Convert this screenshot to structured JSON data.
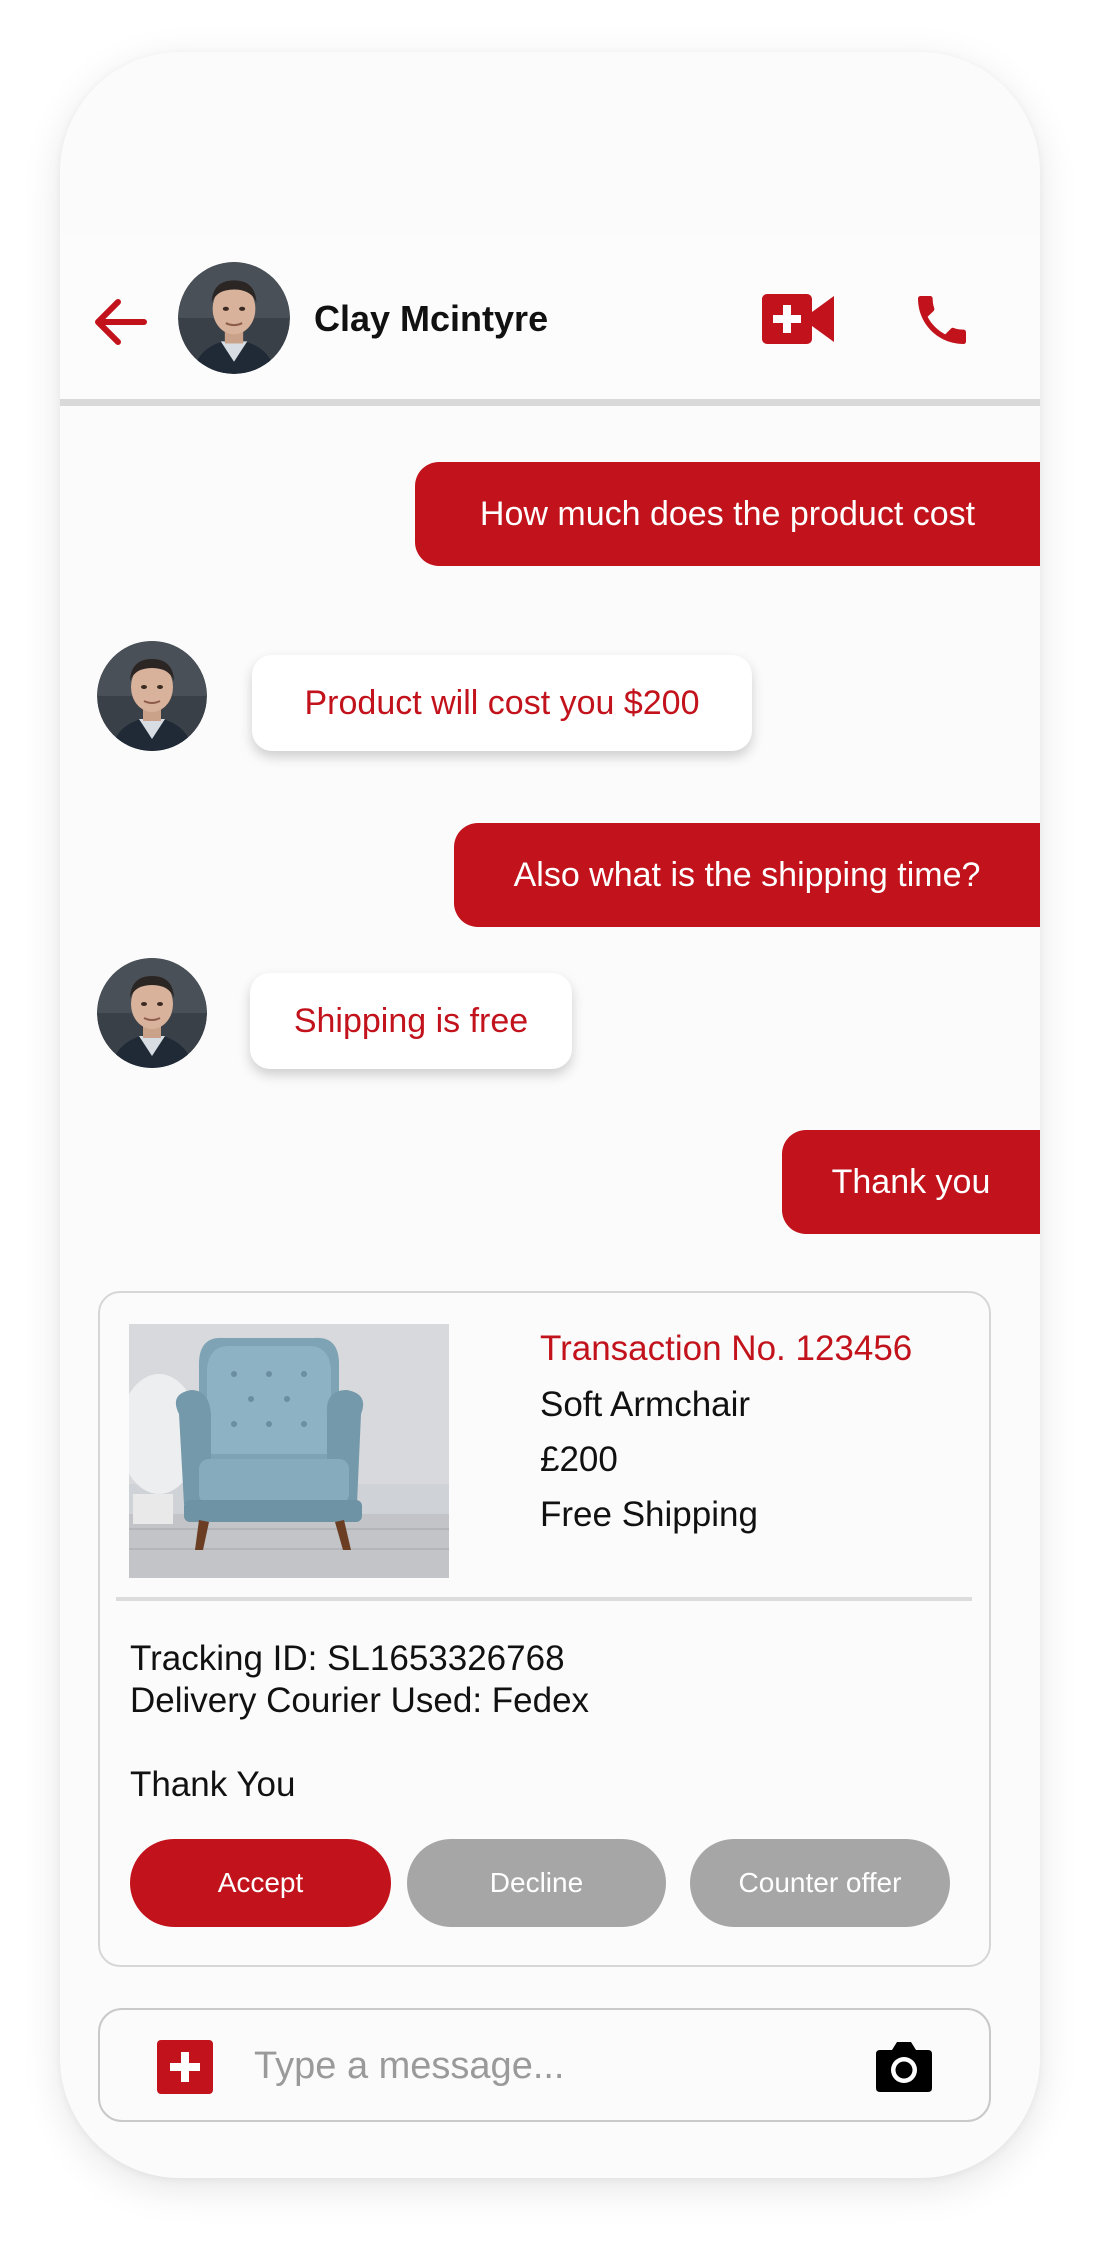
{
  "contact": {
    "name": "Clay Mcintyre"
  },
  "colors": {
    "brand": "#c2121b",
    "neutral_button": "#a6a6a6",
    "background": "#fbfbfb"
  },
  "icons": {
    "back": "arrow-left-icon",
    "video": "video-call-icon",
    "phone": "phone-icon",
    "add": "plus-icon",
    "camera": "camera-icon"
  },
  "messages": [
    {
      "direction": "outgoing",
      "text": "How much does the product cost"
    },
    {
      "direction": "incoming",
      "text": "Product will cost you $200"
    },
    {
      "direction": "outgoing",
      "text": "Also what is the shipping time?"
    },
    {
      "direction": "incoming",
      "text": "Shipping is free"
    },
    {
      "direction": "outgoing",
      "text": "Thank you"
    }
  ],
  "transaction": {
    "number": "Transaction No. 123456",
    "product": "Soft Armchair",
    "price": "£200",
    "shipping": "Free Shipping",
    "tracking": "Tracking ID: SL1653326768",
    "courier": "Delivery Courier Used: Fedex",
    "note": "Thank You",
    "actions": {
      "accept": "Accept",
      "decline": "Decline",
      "counter": "Counter offer"
    }
  },
  "composer": {
    "placeholder": "Type a message..."
  }
}
